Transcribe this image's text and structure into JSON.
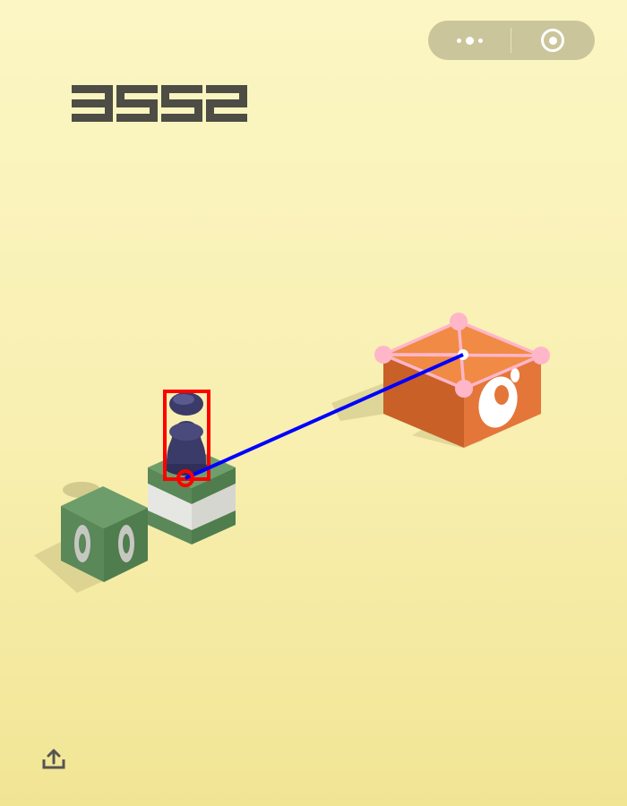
{
  "score": "3552",
  "capsule": {
    "more_icon": "more-dots-icon",
    "close_icon": "target-close-icon"
  },
  "share_icon": "share-upload-icon",
  "colors": {
    "background_top": "#fbf6c4",
    "background_bottom": "#f1e594",
    "score": "#4d4d45",
    "capsule_bg": "#cbc59c",
    "green_block": "#5e8f5e",
    "orange_block": "#e8763a",
    "player": "#3a3a66",
    "overlay_red": "#ff0000",
    "overlay_blue": "#0000ff",
    "overlay_pink": "#ffb6c9"
  }
}
